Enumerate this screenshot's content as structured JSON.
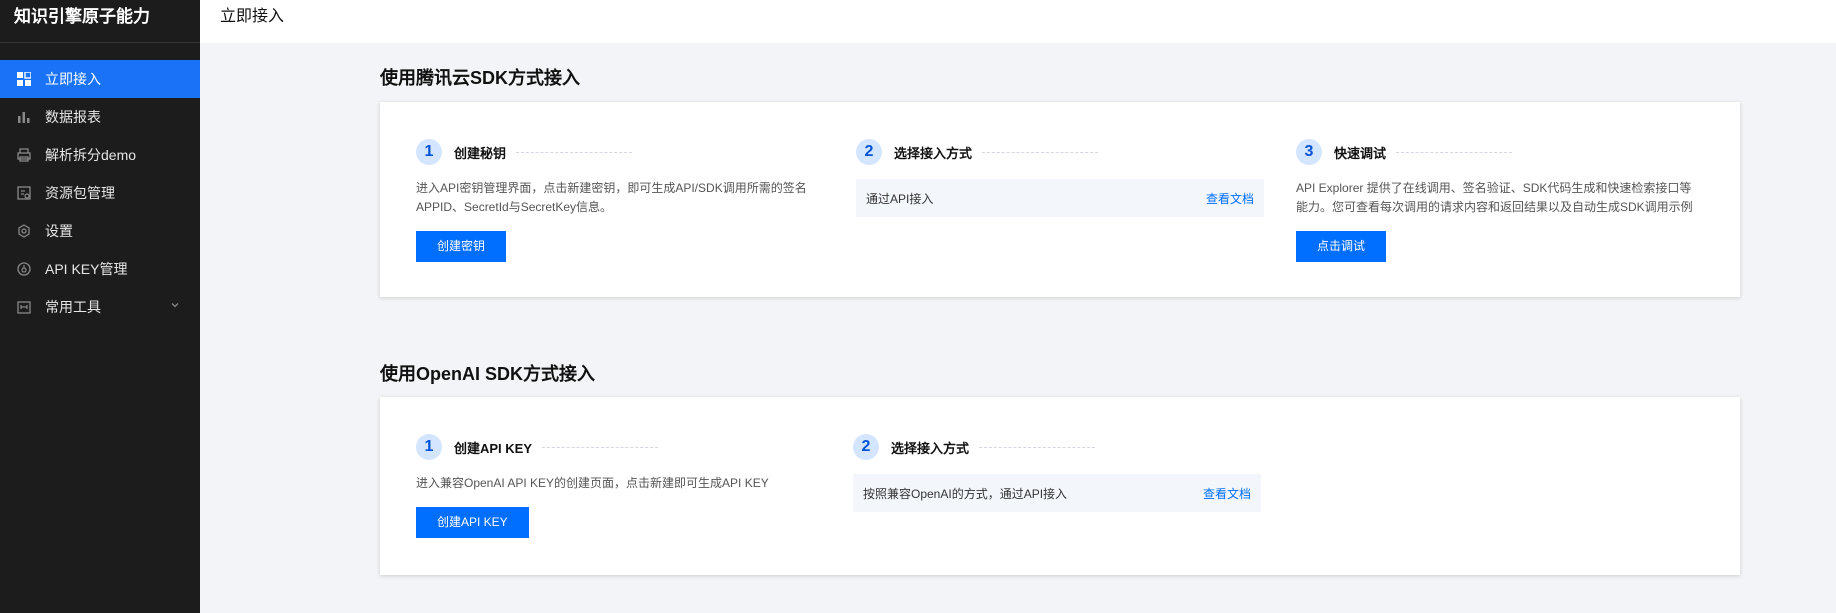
{
  "app": {
    "title": "知识引擎原子能力"
  },
  "sidebar": {
    "items": [
      {
        "label": "立即接入",
        "icon": "grid-icon",
        "active": true
      },
      {
        "label": "数据报表",
        "icon": "bar-chart-icon"
      },
      {
        "label": "解析拆分demo",
        "icon": "printer-icon"
      },
      {
        "label": "资源包管理",
        "icon": "package-icon"
      },
      {
        "label": "设置",
        "icon": "gear-icon"
      },
      {
        "label": "API KEY管理",
        "icon": "key-circle-icon"
      },
      {
        "label": "常用工具",
        "icon": "toolbox-icon",
        "expandable": true
      }
    ]
  },
  "header": {
    "title": "立即接入"
  },
  "sections": [
    {
      "title": "使用腾讯云SDK方式接入",
      "steps": [
        {
          "number": "1",
          "title": "创建秘钥",
          "description": "进入API密钥管理界面，点击新建密钥，即可生成API/SDK调用所需的签名APPID、SecretId与SecretKey信息。",
          "button": "创建密钥"
        },
        {
          "number": "2",
          "title": "选择接入方式",
          "access_text": "通过API接入",
          "link": "查看文档"
        },
        {
          "number": "3",
          "title": "快速调试",
          "description": "API Explorer 提供了在线调用、签名验证、SDK代码生成和快速检索接口等能力。您可查看每次调用的请求内容和返回结果以及自动生成SDK调用示例",
          "button": "点击调试"
        }
      ]
    },
    {
      "title": "使用OpenAI SDK方式接入",
      "steps": [
        {
          "number": "1",
          "title": "创建API KEY",
          "description": "进入兼容OpenAI API KEY的创建页面，点击新建即可生成API KEY",
          "button": "创建API KEY"
        },
        {
          "number": "2",
          "title": "选择接入方式",
          "access_text": "按照兼容OpenAI的方式，通过API接入",
          "link": "查看文档"
        }
      ]
    }
  ],
  "colors": {
    "primary": "#006eff",
    "sidebar_bg": "#1c1c1c",
    "active": "#1a73f6"
  }
}
